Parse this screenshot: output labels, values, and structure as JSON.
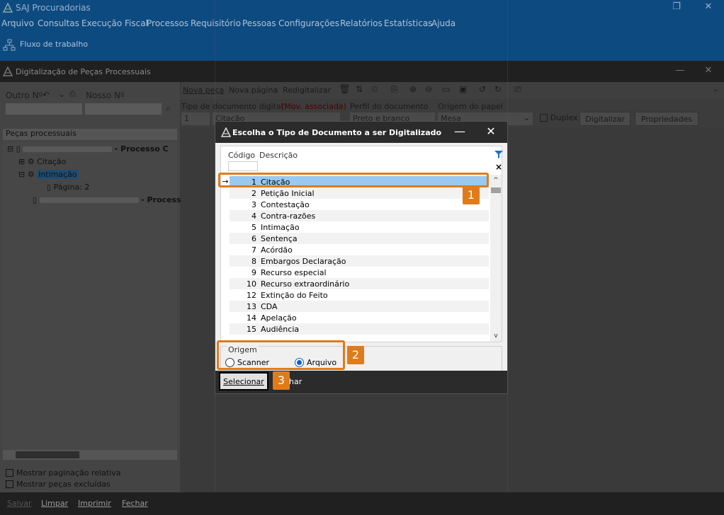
{
  "app": {
    "title": "SAJ Procuradorias",
    "menu": [
      "Arquivo",
      "Consultas",
      "Execução Fiscal",
      "Processos",
      "Requisitório",
      "Pessoas",
      "Configurações",
      "Relatórios",
      "Estatísticas",
      "Ajuda"
    ],
    "workflow_label": "Fluxo de trabalho"
  },
  "digitization": {
    "title": "Digitalização de Peças Processuais",
    "outro_label": "Outro Nº",
    "nosso_label": "Nosso Nº",
    "pecas_header": "Peças processuais",
    "tree": {
      "process1_suffix": "- Processo C",
      "citacao": "Citação",
      "intimacao": "Intimação",
      "pagina": "Página: 2",
      "process2_suffix": "- Process"
    },
    "toolbar": {
      "nova_peca": "Nova peça",
      "nova_pagina": "Nova página",
      "redigitalizar": "Redigitalizar"
    },
    "fields": {
      "tipo_label": "Tipo de documento digital",
      "tipo_assoc": "(Mov. associada)",
      "tipo_code": "1",
      "tipo_value": "Citação",
      "perfil_label": "Perfil do documento",
      "perfil_value": "Preto e branco",
      "origem_label": "Origem do papel",
      "origem_value": "Mesa",
      "duplex": "Duplex",
      "digitalizar": "Digitalizar",
      "propriedades": "Propriedades"
    },
    "options": {
      "paginacao": "Mostrar paginação relativa",
      "excluidas": "Mostrar peças excluídas"
    },
    "bottom": [
      "Salvar",
      "Limpar",
      "Imprimir",
      "Fechar"
    ]
  },
  "modal": {
    "title": "Escolha o Tipo de Documento a ser Digitalizado",
    "col_codigo": "Código",
    "col_descricao": "Descrição",
    "rows": [
      {
        "code": "1",
        "desc": "Citação"
      },
      {
        "code": "2",
        "desc": "Petição Inicial"
      },
      {
        "code": "3",
        "desc": "Contestação"
      },
      {
        "code": "4",
        "desc": "Contra-razões"
      },
      {
        "code": "5",
        "desc": "Intimação"
      },
      {
        "code": "6",
        "desc": "Sentença"
      },
      {
        "code": "7",
        "desc": "Acórdão"
      },
      {
        "code": "8",
        "desc": "Embargos Declaração"
      },
      {
        "code": "9",
        "desc": "Recurso especial"
      },
      {
        "code": "10",
        "desc": "Recurso extraordinário"
      },
      {
        "code": "12",
        "desc": "Extinção do Feito"
      },
      {
        "code": "13",
        "desc": "CDA"
      },
      {
        "code": "14",
        "desc": "Apelação"
      },
      {
        "code": "15",
        "desc": "Audiência"
      }
    ],
    "selected_row": 0,
    "origem_legend": "Origem",
    "scanner": "Scanner",
    "arquivo": "Arquivo",
    "origem_selected": "Arquivo",
    "selecionar": "Selecionar",
    "fechar_partial": "har"
  },
  "callouts": [
    "1",
    "2",
    "3"
  ],
  "colors": {
    "accent": "#e07b1a",
    "selection": "#99c9ef",
    "app_bar": "#0d4a80"
  }
}
